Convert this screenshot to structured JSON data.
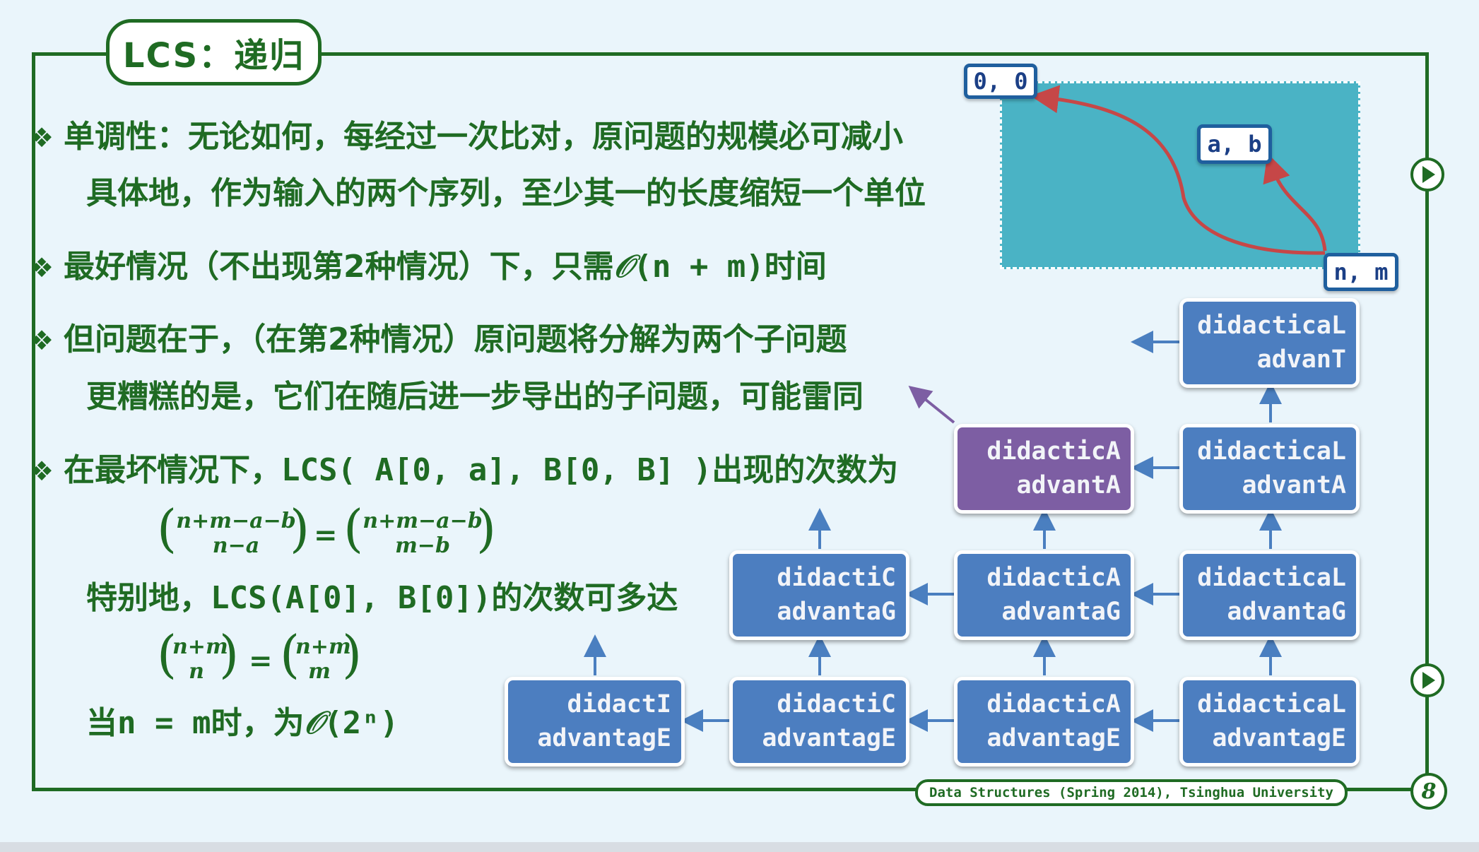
{
  "title": "LCS：递归",
  "bullets": [
    {
      "lines": [
        "单调性：无论如何，每经过一次比对，原问题的规模必可减小",
        "具体地，作为输入的两个序列，至少其一的长度缩短一个单位"
      ]
    },
    {
      "prefix": "最好情况（不出现第2种情况）下，只需",
      "big_o": "𝒪",
      "expr": "(n + m)",
      "suffix": "时间"
    },
    {
      "lines": [
        "但问题在于，（在第2种情况）原问题将分解为两个子问题",
        "更糟糕的是，它们在随后进一步导出的子问题，可能雷同"
      ]
    },
    {
      "prefix": "在最坏情况下，",
      "expr": "LCS( A[0, a], B[0, B] )",
      "suffix": "出现的次数为"
    }
  ],
  "formula1": {
    "left_top": "n+m−a−b",
    "left_bottom": "n−a",
    "right_top": "n+m−a−b",
    "right_bottom": "m−b"
  },
  "special": {
    "prefix": "特别地，",
    "expr": "LCS(A[0], B[0])",
    "suffix": "的次数可多达"
  },
  "formula2": {
    "left_top": "n+m",
    "left_bottom": "n",
    "right_top": "n+m",
    "right_bottom": "m"
  },
  "conclusion": {
    "prefix": "当",
    "expr": "n = m",
    "middle": "时，为",
    "big_o": "𝒪",
    "expr2": "(2ⁿ)"
  },
  "grid_labels": {
    "origin": "0, 0",
    "middle": "a, b",
    "end": "n, m"
  },
  "nodes": [
    {
      "line1": "didacticaL",
      "line2": "advanT"
    },
    {
      "line1": "didacticA",
      "line2": "advantA"
    },
    {
      "line1": "didacticaL",
      "line2": "advantA"
    },
    {
      "line1": "didactiC",
      "line2": "advantaG"
    },
    {
      "line1": "didacticA",
      "line2": "advantaG"
    },
    {
      "line1": "didacticaL",
      "line2": "advantaG"
    },
    {
      "line1": "didactI",
      "line2": "advantagE"
    },
    {
      "line1": "didactiC",
      "line2": "advantagE"
    },
    {
      "line1": "didacticA",
      "line2": "advantagE"
    },
    {
      "line1": "didacticaL",
      "line2": "advantagE"
    }
  ],
  "footer": "Data Structures (Spring 2014), Tsinghua University",
  "page_number": "8",
  "colors": {
    "text_green": "#1f6b23",
    "node_blue": "#4c7ec0",
    "node_purple": "#7d5ea3",
    "grid_teal": "#4ab3c5",
    "path_red": "#c64747",
    "arrow_blue": "#4a7fc0"
  }
}
